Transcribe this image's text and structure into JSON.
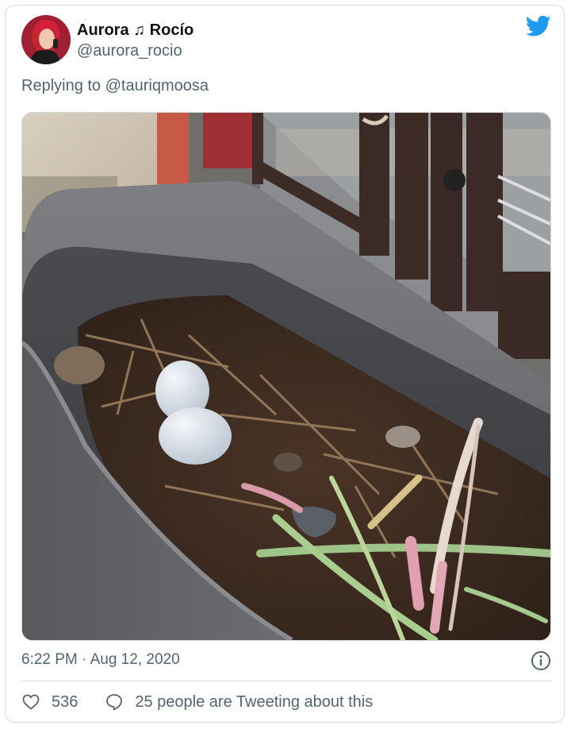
{
  "tweet": {
    "display_name": "Aurora ♫ Rocío",
    "handle": "@aurora_rocio",
    "reply_to": "Replying to @tauriqmoosa",
    "timestamp": "6:22 PM · Aug 12, 2020",
    "like_count": "536",
    "activity_text": "25 people are Tweeting about this"
  },
  "icons": {
    "brand": "twitter-bird-icon",
    "info": "info-icon",
    "like": "heart-icon",
    "reply": "speech-bubble-icon"
  },
  "colors": {
    "twitter_blue": "#1d9bf0",
    "text_primary": "#0f1419",
    "text_secondary": "#536471",
    "border": "#cfd9de"
  }
}
